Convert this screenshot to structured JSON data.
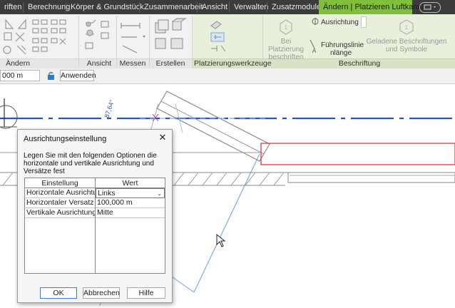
{
  "ribbon": {
    "tabs": [
      {
        "label": "riften"
      },
      {
        "label": "Berechnung"
      },
      {
        "label": "Körper & Grundstück"
      },
      {
        "label": "Zusammenarbeit"
      },
      {
        "label": "Ansicht"
      },
      {
        "label": "Verwalten"
      },
      {
        "label": "Zusatzmodule"
      },
      {
        "label": "Ändern | Platzieren Luftkanal"
      }
    ],
    "panels": {
      "aendern": "Ändern",
      "ansicht": "Ansicht",
      "messen": "Messen",
      "erstellen": "Erstellen",
      "platzierungswerkzeuge": "Platzierungswerkzeuge",
      "beschriftung": "Beschriftung"
    },
    "tools": {
      "tag_on_placement": "Bei Platzierung beschriften",
      "alignment": "Ausrichtung",
      "leader_line": "Führungslinie",
      "leader_length": "nlänge",
      "loaded_tags": "Geladene Beschriftungen und Symbole"
    }
  },
  "options_bar": {
    "value": "000 m",
    "apply_label": "Anwenden"
  },
  "canvas": {
    "dimension_text": "87,64°"
  },
  "dialog": {
    "title": "Ausrichtungseinstellung",
    "description": "Legen Sie mit den folgenden Optionen die horizontale und vertikale Ausrichtung und Versätze fest",
    "columns": {
      "setting": "Einstellung",
      "value": "Wert"
    },
    "rows": [
      {
        "setting": "Horizontale Ausrichtun",
        "value": "Links"
      },
      {
        "setting": "Horizontaler Versatz",
        "value": "100,000 m"
      },
      {
        "setting": "Vertikale Ausrichtung",
        "value": "Mitte"
      }
    ],
    "buttons": {
      "ok": "OK",
      "cancel": "Abbrechen",
      "help": "Hilfe"
    }
  }
}
